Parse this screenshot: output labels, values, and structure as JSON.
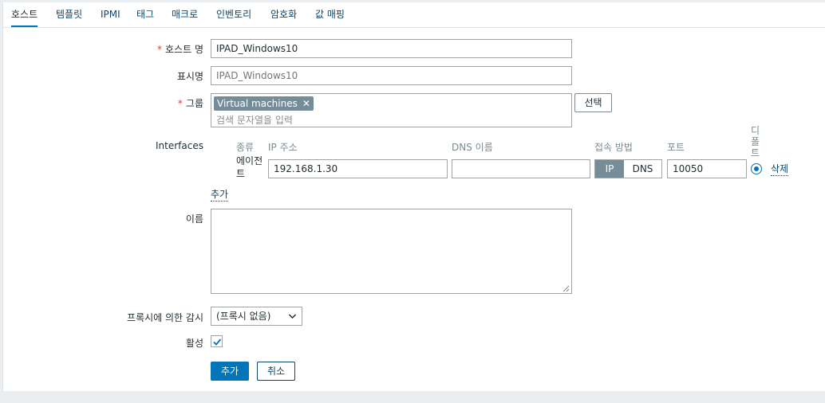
{
  "tabs": [
    {
      "label": "호스트",
      "active": true
    },
    {
      "label": "템플릿"
    },
    {
      "label": "IPMI"
    },
    {
      "label": "태그"
    },
    {
      "label": "매크로"
    },
    {
      "label": "인벤토리"
    },
    {
      "label": "암호화"
    },
    {
      "label": "값 매핑"
    }
  ],
  "form": {
    "host_name": {
      "label": "호스트 명",
      "required": true,
      "value": "IPAD_Windows10"
    },
    "visible_name": {
      "label": "표시명",
      "placeholder": "IPAD_Windows10"
    },
    "groups": {
      "label": "그룹",
      "required": true,
      "chip": "Virtual machines",
      "placeholder": "검색 문자열을 입력",
      "select_label": "선택"
    },
    "interfaces": {
      "label": "Interfaces",
      "headers": {
        "type": "종류",
        "ip": "IP 주소",
        "dns": "DNS 이름",
        "connect": "접속 방법",
        "port": "포트",
        "default": "디폴트"
      },
      "row": {
        "type": "에이전트",
        "ip": "192.168.1.30",
        "dns": "",
        "connect_ip": "IP",
        "connect_dns": "DNS",
        "port": "10050",
        "remove": "삭제"
      },
      "add": "추가"
    },
    "description": {
      "label": "이름",
      "value": ""
    },
    "proxy": {
      "label": "프록시에 의한 감시",
      "value": "(프록시 없음)"
    },
    "enabled": {
      "label": "활성",
      "checked": true
    },
    "buttons": {
      "add": "추가",
      "cancel": "취소"
    }
  },
  "colors": {
    "accent": "#0275b8",
    "link": "#0a466a",
    "required": "#e33734",
    "toggle_on": "#768d99"
  }
}
